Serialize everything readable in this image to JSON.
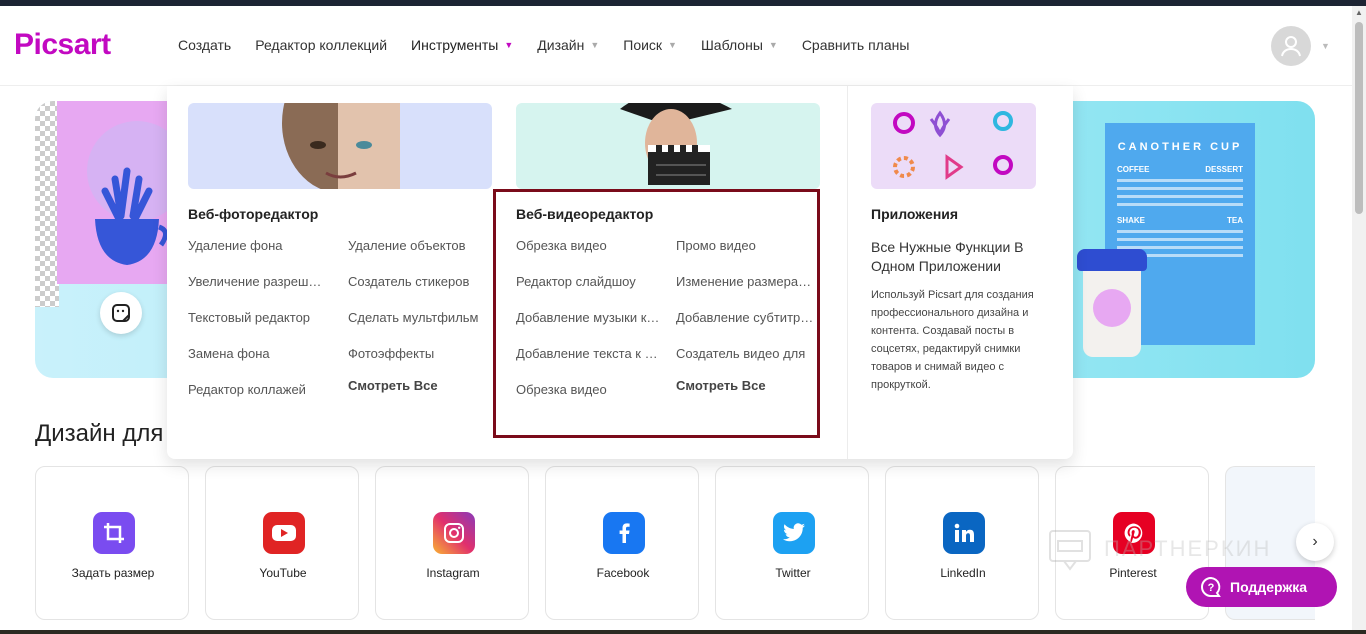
{
  "brand": {
    "logo_text": "Picsart",
    "accent": "#c209c1"
  },
  "nav": {
    "items": [
      {
        "label": "Создать",
        "caret": false,
        "active": false
      },
      {
        "label": "Редактор коллекций",
        "caret": false,
        "active": false
      },
      {
        "label": "Инструменты",
        "caret": true,
        "active": true
      },
      {
        "label": "Дизайн",
        "caret": true,
        "active": false
      },
      {
        "label": "Поиск",
        "caret": true,
        "active": false
      },
      {
        "label": "Шаблоны",
        "caret": true,
        "active": false
      },
      {
        "label": "Сравнить планы",
        "caret": false,
        "active": false
      }
    ]
  },
  "mega_menu": {
    "photo": {
      "title": "Веб-фоторедактор",
      "links": [
        "Удаление фона",
        "Удаление объектов",
        "Увеличение разрешения",
        "Создатель стикеров",
        "Текстовый редактор",
        "Сделать мультфильм",
        "Замена фона",
        "Фотоэффекты",
        "Редактор коллажей",
        "Смотреть Все"
      ]
    },
    "video": {
      "title": "Веб-видеоредактор",
      "links": [
        "Обрезка видео",
        "Промо видео",
        "Редактор слайдшоу",
        "Изменение размера видео",
        "Добавление музыки к видео",
        "Добавление субтитров",
        "Добавление текста к видео",
        "Создатель видео для",
        "Обрезка видео",
        "Смотреть Все"
      ]
    },
    "apps": {
      "title": "Приложения",
      "headline": "Все Нужные Функции В Одном Приложении",
      "body": "Используй Picsart для создания профессионального дизайна и контента. Создавай посты в соцсетях, редактируй снимки товаров и снимай видео с прокруткой."
    }
  },
  "hero": {
    "poster_title": "CANOTHER CUP",
    "poster_col1": "COFFEE",
    "poster_col2": "DESSERT",
    "poster_col3": "SHAKE",
    "poster_col4": "TEA"
  },
  "section": {
    "title": "Дизайн для"
  },
  "cards": [
    {
      "label": "Задать размер",
      "icon": "crop-icon",
      "bg": "#f6f3fb",
      "color": "#7a4cf0"
    },
    {
      "label": "YouTube",
      "icon": "youtube-icon",
      "bg": "#fdf4f4",
      "color": "#e02424"
    },
    {
      "label": "Instagram",
      "icon": "instagram-icon",
      "bg": "#fdf3f6",
      "color": "#e1306c"
    },
    {
      "label": "Facebook",
      "icon": "facebook-icon",
      "bg": "#f2f6fc",
      "color": "#1877f2"
    },
    {
      "label": "Twitter",
      "icon": "twitter-icon",
      "bg": "#f1f9fd",
      "color": "#1da1f2"
    },
    {
      "label": "LinkedIn",
      "icon": "linkedin-icon",
      "bg": "#f1f6fa",
      "color": "#0a66c2"
    },
    {
      "label": "Pinterest",
      "icon": "pinterest-icon",
      "bg": "#fdf3f4",
      "color": "#e60023"
    }
  ],
  "watermark": {
    "text": "ПАРТНЕРКИН"
  },
  "support": {
    "label": "Поддержка"
  }
}
